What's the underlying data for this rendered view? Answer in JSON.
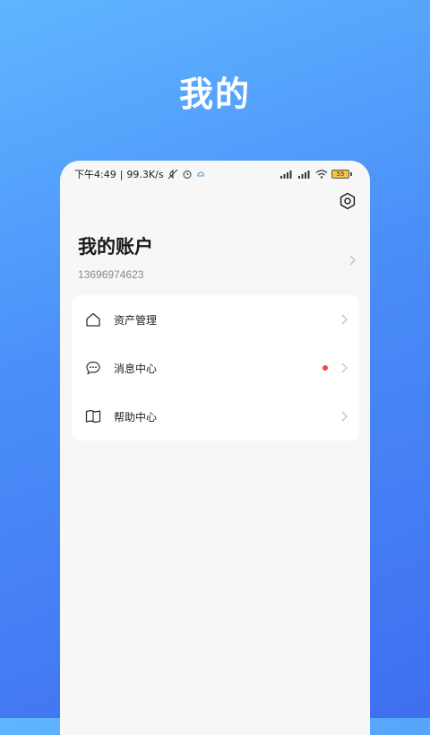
{
  "page": {
    "title": "我的"
  },
  "status_bar": {
    "time": "下午4:49",
    "separator": "|",
    "speed": "99.3K/s",
    "battery": "55"
  },
  "account": {
    "title": "我的账户",
    "phone": "13696974623"
  },
  "menu": {
    "items": [
      {
        "label": "资产管理",
        "icon": "home-icon",
        "badge": false
      },
      {
        "label": "消息中心",
        "icon": "chat-bubble-icon",
        "badge": true
      },
      {
        "label": "帮助中心",
        "icon": "book-icon",
        "badge": false
      }
    ]
  },
  "colors": {
    "gradient_top": "#5fb6ff",
    "gradient_bottom": "#3f6ff0",
    "badge": "#f0483e",
    "battery_fill": "#f5c542"
  }
}
